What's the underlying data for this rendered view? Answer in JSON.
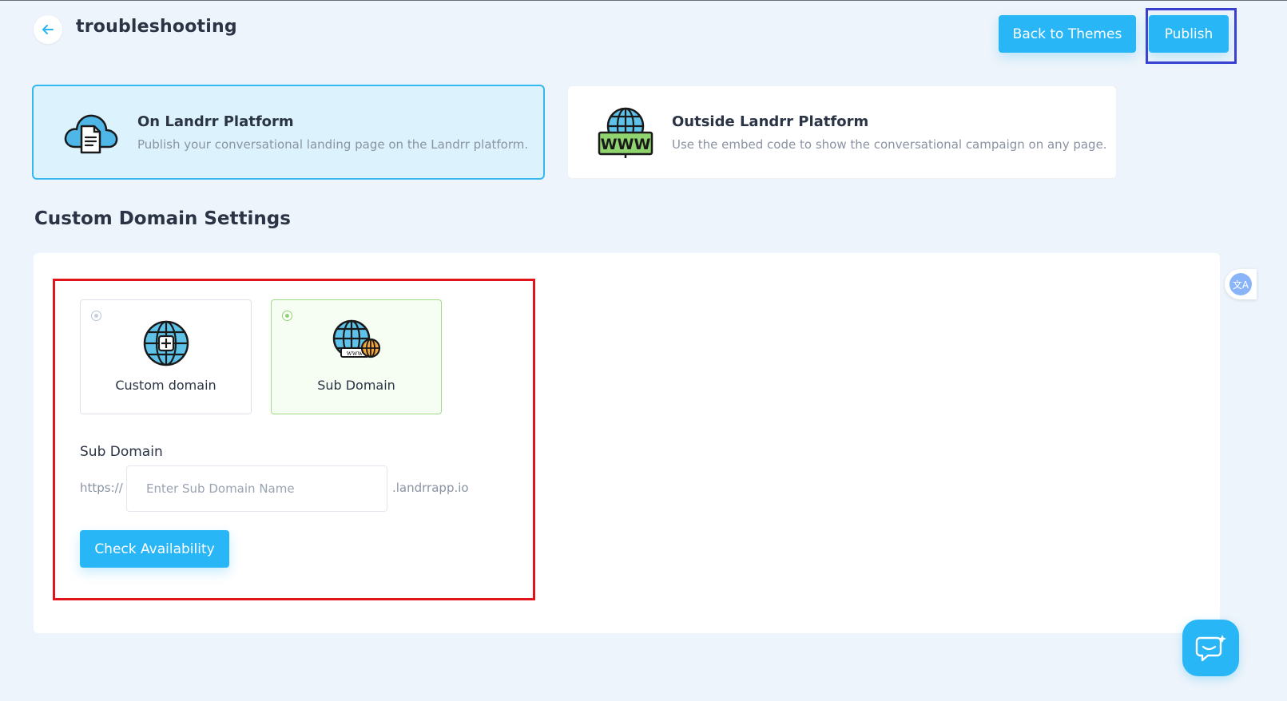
{
  "header": {
    "title": "troubleshooting",
    "back_themes_label": "Back to Themes",
    "publish_label": "Publish"
  },
  "platforms": {
    "on": {
      "title": "On Landrr Platform",
      "description": "Publish your conversational landing page on the Landrr platform.",
      "icon": "cloud-document-icon"
    },
    "out": {
      "title": "Outside Landrr Platform",
      "description": "Use the embed code to show the conversational campaign on any page.",
      "icon": "www-globe-icon"
    }
  },
  "domain_settings": {
    "section_title": "Custom Domain Settings",
    "options": [
      {
        "label": "Custom domain",
        "selected": false,
        "icon": "globe-plus-icon"
      },
      {
        "label": "Sub Domain",
        "selected": true,
        "icon": "globe-www-icon"
      }
    ],
    "sub_domain": {
      "label": "Sub Domain",
      "prefix": "https://",
      "placeholder": "Enter Sub Domain Name",
      "value": "",
      "suffix": ".landrrapp.io"
    },
    "check_label": "Check Availability"
  },
  "widgets": {
    "translate_glyph": "文A",
    "chat_icon": "chat-icon"
  },
  "colors": {
    "accent": "#29b6f6",
    "page_bg": "#eef4fb",
    "highlight_red": "#e0151b",
    "highlight_blue": "#3a3fd0",
    "selected_green": "#8fd46f"
  }
}
